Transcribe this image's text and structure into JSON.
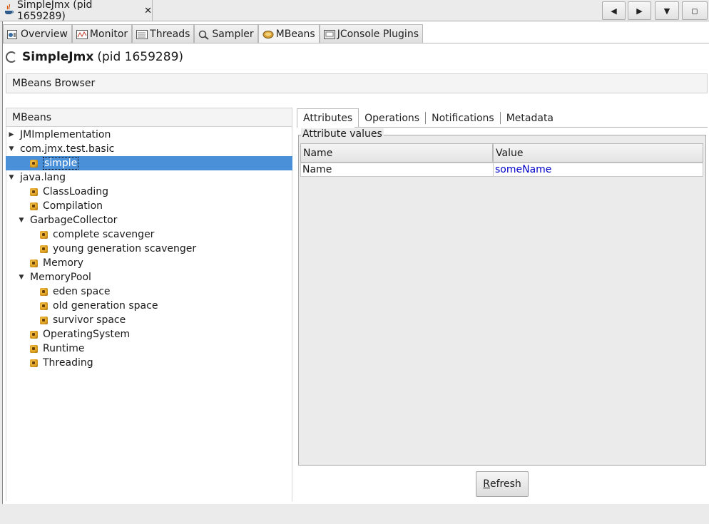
{
  "window": {
    "doc_tab_title": "SimpleJmx (pid 1659289)",
    "close_glyph": "✕",
    "nav_buttons": [
      "◀",
      "▶",
      "▼",
      "◻"
    ]
  },
  "tabs": [
    {
      "label": "Overview",
      "icon": "overview-icon"
    },
    {
      "label": "Monitor",
      "icon": "monitor-icon"
    },
    {
      "label": "Threads",
      "icon": "threads-icon"
    },
    {
      "label": "Sampler",
      "icon": "sampler-icon"
    },
    {
      "label": "MBeans",
      "icon": "mbeans-icon",
      "active": true
    },
    {
      "label": "JConsole Plugins",
      "icon": "plugins-icon"
    }
  ],
  "connection": {
    "name": "SimpleJmx",
    "pid_text": "(pid 1659289)"
  },
  "browser": {
    "header": "MBeans Browser"
  },
  "tree": {
    "header": "MBeans",
    "nodes": [
      {
        "label": "JMImplementation",
        "level": 0,
        "type": "folder",
        "expanded": false
      },
      {
        "label": "com.jmx.test.basic",
        "level": 0,
        "type": "folder",
        "expanded": true
      },
      {
        "label": "simple",
        "level": 2,
        "type": "bean",
        "selected": true
      },
      {
        "label": "java.lang",
        "level": 0,
        "type": "folder",
        "expanded": true
      },
      {
        "label": "ClassLoading",
        "level": 1,
        "type": "bean"
      },
      {
        "label": "Compilation",
        "level": 1,
        "type": "bean"
      },
      {
        "label": "GarbageCollector",
        "level": 1,
        "type": "folder",
        "expanded": true
      },
      {
        "label": "complete scavenger",
        "level": 2,
        "type": "bean"
      },
      {
        "label": "young generation scavenger",
        "level": 2,
        "type": "bean"
      },
      {
        "label": "Memory",
        "level": 1,
        "type": "bean"
      },
      {
        "label": "MemoryPool",
        "level": 1,
        "type": "folder",
        "expanded": true
      },
      {
        "label": "eden space",
        "level": 2,
        "type": "bean"
      },
      {
        "label": "old generation space",
        "level": 2,
        "type": "bean"
      },
      {
        "label": "survivor space",
        "level": 2,
        "type": "bean"
      },
      {
        "label": "OperatingSystem",
        "level": 1,
        "type": "bean"
      },
      {
        "label": "Runtime",
        "level": 1,
        "type": "bean"
      },
      {
        "label": "Threading",
        "level": 1,
        "type": "bean"
      }
    ]
  },
  "detail": {
    "tabs": [
      {
        "label": "Attributes",
        "active": true
      },
      {
        "label": "Operations"
      },
      {
        "label": "Notifications"
      },
      {
        "label": "Metadata"
      }
    ],
    "group_label": "Attribute values",
    "columns": [
      "Name",
      "Value"
    ],
    "rows": [
      {
        "name": "Name",
        "value": "someName"
      }
    ],
    "refresh_mnemonic": "R",
    "refresh_rest": "efresh"
  },
  "colors": {
    "selection": "#4a90d9",
    "value_text": "#0000c8"
  }
}
